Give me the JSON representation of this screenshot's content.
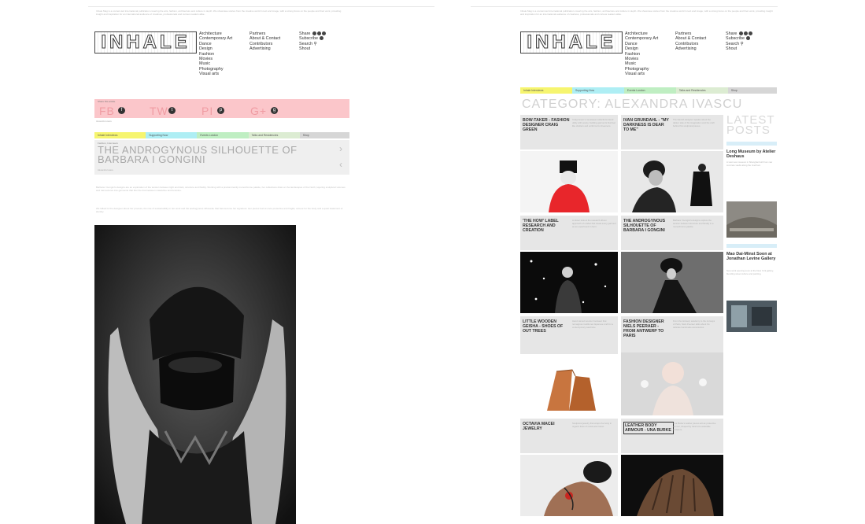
{
  "site": {
    "logo": "INHALE",
    "menu_col1": [
      "Architecture",
      "Contemporary Art",
      "Dance",
      "Design",
      "Fashion",
      "Movies",
      "Music",
      "Photography",
      "Visual arts"
    ],
    "menu_col2": [
      "Partners",
      "About & Contact",
      "Contributors",
      "Advertising"
    ],
    "menu_col3": [
      "Share",
      "Subscribe",
      "Search",
      "Shout"
    ],
    "intro_text": "Inhale Mag is a content-led international publication covering the arts, fashion, architecture and culture in depth. We showcase stories from the creative world in text and image, with a strong focus on the people and their work, providing insight and inspiration for an international audience of creatives, professionals and curious readers alike."
  },
  "category_strip": [
    {
      "label": "Inhale Interviews",
      "color": "#f6f56f"
    },
    {
      "label": "Supporting Now",
      "color": "#aeeef4"
    },
    {
      "label": "Events London",
      "color": "#bfeec2"
    },
    {
      "label": "Talks and Residencies",
      "color": "#dcecd2"
    },
    {
      "label": "Shop",
      "color": "#d6d6d6"
    }
  ],
  "share_bar": {
    "tag": "Share this article",
    "networks": [
      "FB",
      "TW",
      "PI",
      "G+"
    ],
    "icons": [
      "facebook-icon",
      "twitter-icon",
      "pinterest-icon",
      "googleplus-icon"
    ],
    "color": "#fbc6ca"
  },
  "left_post": {
    "category": "Fashion, Interviews",
    "title": "THE ANDROGYNOUS SILHOUETTE OF BARBARA I GONGINI",
    "byline": "Alexandra Ivascu",
    "body_para1": "Barbara I Gongini's designs are an exploration of the tension between light and dark, structure and fluidity. Working with a predominantly monochrome palette, her collections draw on the landscapes of the North, layering sculptural volumes and raw textures into garments that blur the line between masculine and feminine.",
    "body_para2": "We talked to the designer about her process, the role of sustainability in her work and the androgynous silhouette that has become her signature. Her pieces feel at once protective and fragile, armour for the body and a quiet statement of identity."
  },
  "right_page": {
    "category_title": "CATEGORY: ALEXANDRA IVASCU",
    "posts": [
      {
        "title": "BOW-TAKER - FASHION DESIGNER CRAIG GREEN",
        "excerpt": "Craig Green's menswear collections blend utility with poetry, building garments that feel like shelters and uniforms for dreamers."
      },
      {
        "title": "IVAN GRUNDAHL - \"MY DARKNESS IS DEAR TO ME\"",
        "excerpt": "The Danish designer speaks about the darker side of his imagination and the craft behind his sculptural pieces."
      },
      {
        "title": "'THE HOW' LABEL RESEARCH AND CREATION",
        "excerpt": "A closer look at the research driven approach of a label that treats every garment as an experiment in form."
      },
      {
        "title": "THE ANDROGYNOUS SILHOUETTE OF BARBARA I GONGINI",
        "excerpt": "Barbara I Gongini's designs explore the tension between structure and fluidity in a monochrome palette."
      },
      {
        "title": "LITTLE WOODEN GEISHA - SHOES OF OUT TREES",
        "excerpt": "Hand carved wooden footwear that reimagines traditional Japanese craft for a contemporary wardrobe."
      },
      {
        "title": "FASHION DESIGNER NIELS PEERAER - FROM ANTWERP TO PARIS",
        "excerpt": "From the Antwerp academy to the runways of Paris, Niels Peeraer talks about his delicate handmade accessories."
      },
      {
        "title": "OCTAVIA MACEI JEWELRY",
        "excerpt": "Sculptural jewelry that wraps the body in organic lines of metal and colour."
      },
      {
        "title": "LEATHER BODY ARMOUR - UNA BURKE",
        "excerpt": "Una Burke's leather pieces act as protective armour, shaped by hand into wearable sculpture."
      }
    ],
    "sidebar": {
      "title": "LATEST POSTS",
      "posts": [
        {
          "title": "Long Museum by Atelier Deshaus",
          "excerpt": "A vast new museum in Shanghai built from raw concrete vaults along the riverfront."
        },
        {
          "title": "Mao Dai-Minst Soon at Jonathan Levine Gallery",
          "excerpt": "New work opening soon at the New York gallery, blending street culture and painting."
        }
      ]
    }
  },
  "colors": {
    "text_dark": "#222222",
    "title_grey": "#a8a8a8",
    "card_bg": "#e6e6e6"
  }
}
